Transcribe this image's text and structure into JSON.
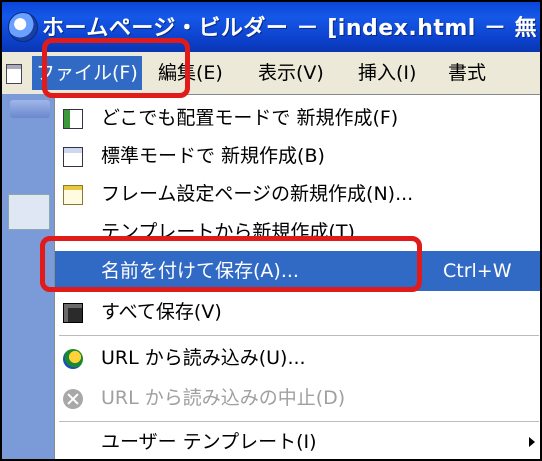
{
  "window": {
    "title": "ホームページ・ビルダー － [index.html － 無"
  },
  "menubar": {
    "items": [
      {
        "label": "ファイル(F)",
        "active": true
      },
      {
        "label": "編集(E)"
      },
      {
        "label": "表示(V)"
      },
      {
        "label": "挿入(I)"
      },
      {
        "label": "書式"
      }
    ]
  },
  "file_menu": {
    "items": [
      {
        "label": "どこでも配置モードで 新規作成(F)",
        "icon": "new-anywhere-doc-icon"
      },
      {
        "label": "標準モードで 新規作成(B)",
        "icon": "new-standard-doc-icon"
      },
      {
        "label": "フレーム設定ページの新規作成(N)...",
        "icon": "frame-page-icon"
      },
      {
        "label": "テンプレートから新規作成(T)"
      },
      {
        "label": "名前を付けて保存(A)...",
        "shortcut": "Ctrl+W",
        "highlighted": true
      },
      {
        "label": "すべて保存(V)",
        "icon": "save-all-icon"
      },
      {
        "label": "URL から読み込み(U)...",
        "icon": "url-load-icon"
      },
      {
        "label": "URL から読み込みの中止(D)",
        "icon": "stop-load-icon",
        "disabled": true
      },
      {
        "label": "ユーザー テンプレート(I)",
        "submenu": true
      }
    ]
  },
  "colors": {
    "highlight": "#316ac5",
    "annotation": "#e11a1a",
    "titlebar": "#0a44d8"
  }
}
